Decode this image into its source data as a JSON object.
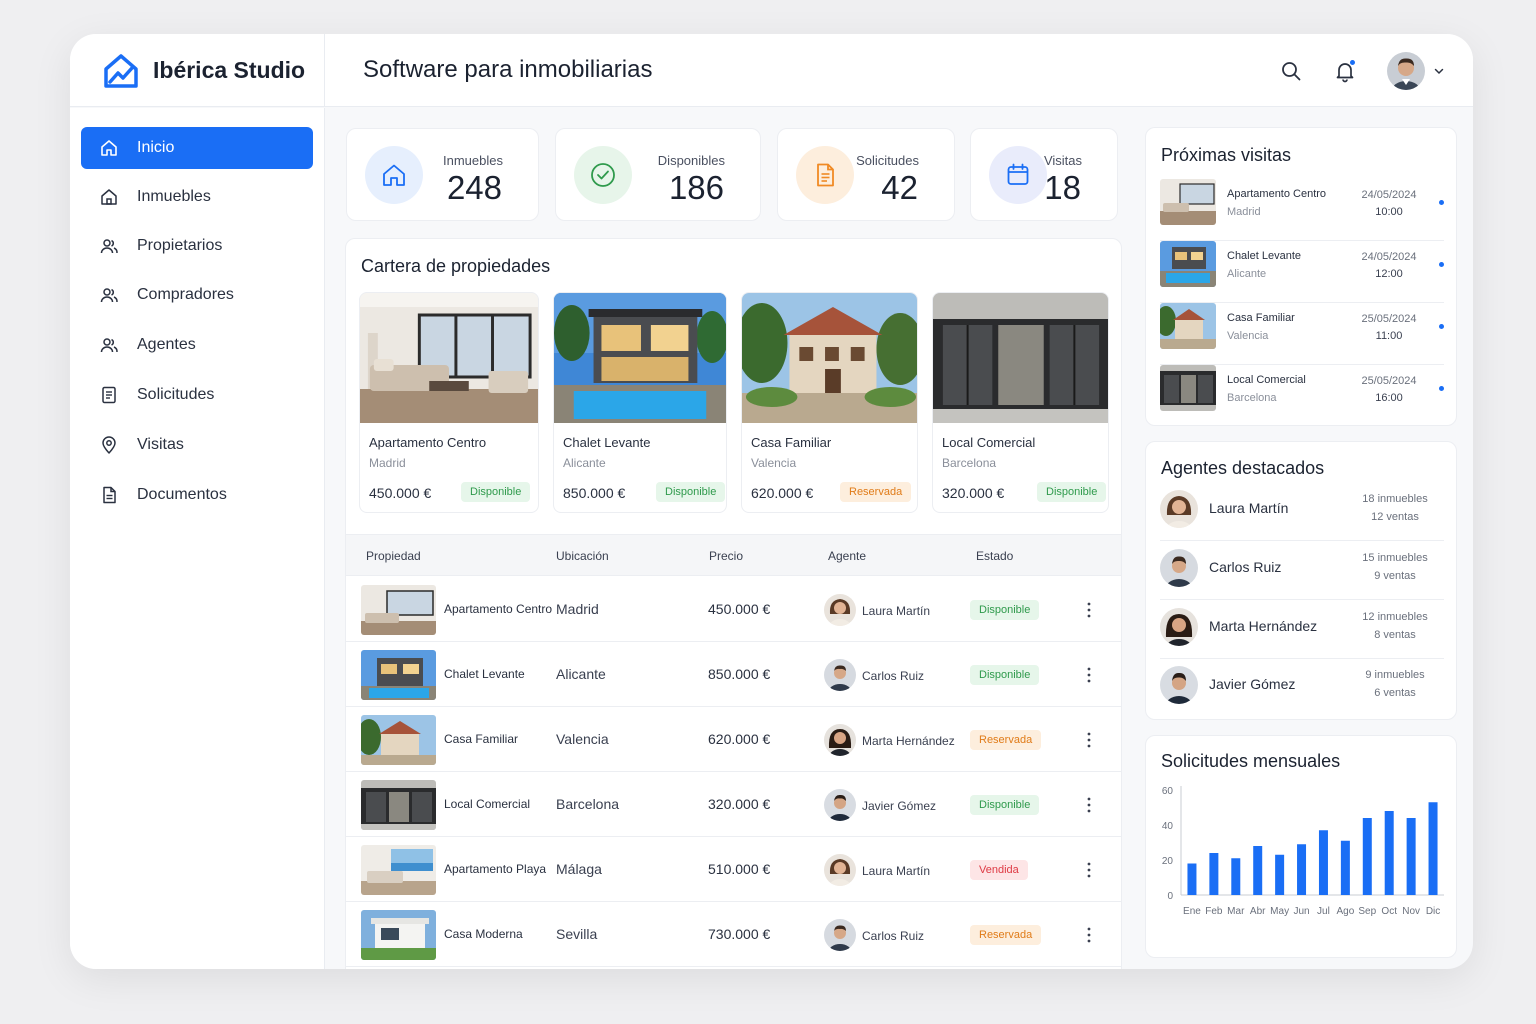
{
  "app": {
    "brand": "Ibérica Studio",
    "title": "Software para inmobiliarias"
  },
  "header": {
    "icons": [
      "search-icon",
      "bell-icon",
      "user-avatar",
      "chevron-down-icon"
    ],
    "notification_dot": true
  },
  "sidebar": {
    "items": [
      {
        "label": "Inicio",
        "icon": "home-icon",
        "active": true
      },
      {
        "label": "Inmuebles",
        "icon": "home-outline-icon"
      },
      {
        "label": "Propietarios",
        "icon": "users-icon"
      },
      {
        "label": "Compradores",
        "icon": "users-icon"
      },
      {
        "label": "Agentes",
        "icon": "users-icon"
      },
      {
        "label": "Solicitudes",
        "icon": "document-list-icon"
      },
      {
        "label": "Visitas",
        "icon": "location-pin-icon"
      },
      {
        "label": "Documentos",
        "icon": "document-icon"
      }
    ]
  },
  "stats": [
    {
      "label": "Inmuebles",
      "value": "248",
      "icon": "home-icon",
      "color": "#1a6ef5"
    },
    {
      "label": "Disponibles",
      "value": "186",
      "icon": "check-circle-icon",
      "color": "#2f9a4c"
    },
    {
      "label": "Solicitudes",
      "value": "42",
      "icon": "document-icon",
      "color": "#f08a24"
    },
    {
      "label": "Visitas",
      "value": "18",
      "icon": "calendar-icon",
      "color": "#1a6ef5"
    }
  ],
  "portfolio": {
    "title": "Cartera de propiedades",
    "cards": [
      {
        "name": "Apartamento Centro",
        "city": "Madrid",
        "price": "450.000 €",
        "status": "Disponible"
      },
      {
        "name": "Chalet Levante",
        "city": "Alicante",
        "price": "850.000 €",
        "status": "Disponible"
      },
      {
        "name": "Casa Familiar",
        "city": "Valencia",
        "price": "620.000 €",
        "status": "Reservada"
      },
      {
        "name": "Local Comercial",
        "city": "Barcelona",
        "price": "320.000 €",
        "status": "Disponible"
      }
    ]
  },
  "table": {
    "columns": [
      "Propiedad",
      "Ubicación",
      "Precio",
      "Agente",
      "Estado"
    ],
    "rows": [
      {
        "name": "Apartamento Centro",
        "location": "Madrid",
        "price": "450.000 €",
        "agent": "Laura Martín",
        "status": "Disponible"
      },
      {
        "name": "Chalet Levante",
        "location": "Alicante",
        "price": "850.000 €",
        "agent": "Carlos Ruiz",
        "status": "Disponible"
      },
      {
        "name": "Casa Familiar",
        "location": "Valencia",
        "price": "620.000 €",
        "agent": "Marta Hernández",
        "status": "Reservada"
      },
      {
        "name": "Local Comercial",
        "location": "Barcelona",
        "price": "320.000 €",
        "agent": "Javier Gómez",
        "status": "Disponible"
      },
      {
        "name": "Apartamento Playa",
        "location": "Málaga",
        "price": "510.000 €",
        "agent": "Laura Martín",
        "status": "Vendida"
      },
      {
        "name": "Casa Moderna",
        "location": "Sevilla",
        "price": "730.000 €",
        "agent": "Carlos Ruiz",
        "status": "Reservada"
      }
    ]
  },
  "visits": {
    "title": "Próximas visitas",
    "items": [
      {
        "name": "Apartamento Centro",
        "city": "Madrid",
        "date": "24/05/2024",
        "time": "10:00"
      },
      {
        "name": "Chalet Levante",
        "city": "Alicante",
        "date": "24/05/2024",
        "time": "12:00"
      },
      {
        "name": "Casa Familiar",
        "city": "Valencia",
        "date": "25/05/2024",
        "time": "11:00"
      },
      {
        "name": "Local Comercial",
        "city": "Barcelona",
        "date": "25/05/2024",
        "time": "16:00"
      }
    ]
  },
  "agents": {
    "title": "Agentes destacados",
    "items": [
      {
        "name": "Laura Martín",
        "properties": "18 inmuebles",
        "sales": "12 ventas"
      },
      {
        "name": "Carlos Ruiz",
        "properties": "15 inmuebles",
        "sales": "9 ventas"
      },
      {
        "name": "Marta Hernández",
        "properties": "12 inmuebles",
        "sales": "8 ventas"
      },
      {
        "name": "Javier Gómez",
        "properties": "9 inmuebles",
        "sales": "6 ventas"
      }
    ]
  },
  "colors": {
    "accent": "#1a6ef5",
    "available": "#2f9a4c",
    "reserved": "#e07b18",
    "sold": "#de3a44"
  },
  "chart_data": {
    "type": "bar",
    "title": "Solicitudes mensuales",
    "categories": [
      "Ene",
      "Feb",
      "Mar",
      "Abr",
      "May",
      "Jun",
      "Jul",
      "Ago",
      "Sep",
      "Oct",
      "Nov",
      "Dic"
    ],
    "values": [
      18,
      24,
      21,
      28,
      23,
      29,
      37,
      31,
      44,
      48,
      44,
      53
    ],
    "ylim": [
      0,
      60
    ],
    "yticks": [
      0,
      20,
      40,
      60
    ],
    "grid": false,
    "legend": "none"
  }
}
